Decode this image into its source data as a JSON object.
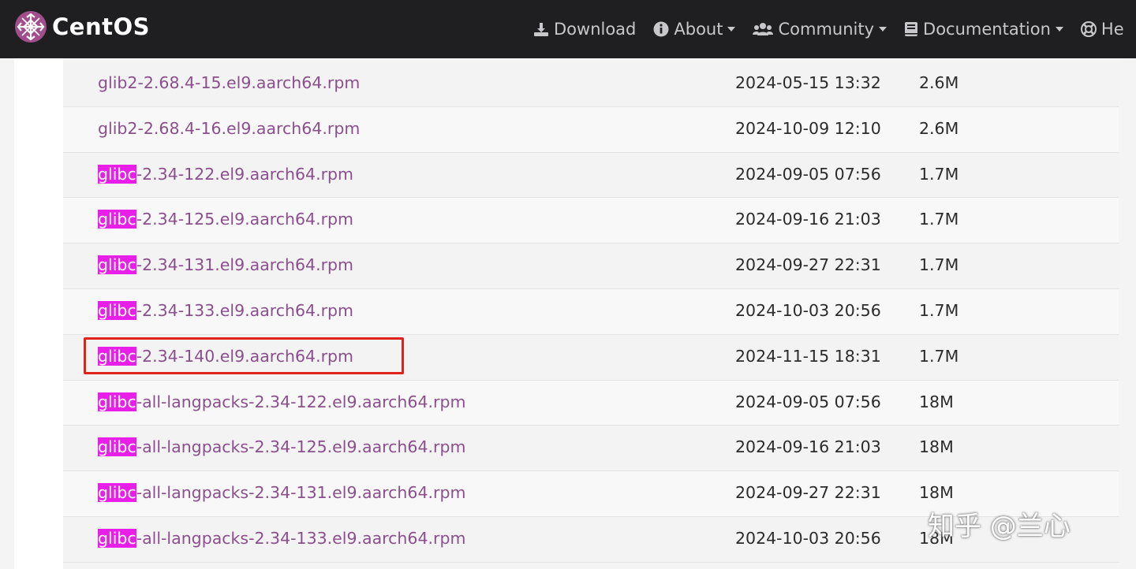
{
  "brand": {
    "name": "CentOS"
  },
  "nav": {
    "items": [
      {
        "label": "Download",
        "icon": "download-icon",
        "dropdown": false
      },
      {
        "label": "About",
        "icon": "info-icon",
        "dropdown": true
      },
      {
        "label": "Community",
        "icon": "users-icon",
        "dropdown": true
      },
      {
        "label": "Documentation",
        "icon": "book-icon",
        "dropdown": true
      },
      {
        "label": "He",
        "icon": "help-icon",
        "dropdown": false
      }
    ]
  },
  "highlight_term": "glibc",
  "files": [
    {
      "prefix": "",
      "rest": "glib2-2.68.4-15.el9.aarch64.rpm",
      "date": "2024-05-15 13:32",
      "size": "2.6M"
    },
    {
      "prefix": "",
      "rest": "glib2-2.68.4-16.el9.aarch64.rpm",
      "date": "2024-10-09 12:10",
      "size": "2.6M"
    },
    {
      "prefix": "glibc",
      "rest": "-2.34-122.el9.aarch64.rpm",
      "date": "2024-09-05 07:56",
      "size": "1.7M"
    },
    {
      "prefix": "glibc",
      "rest": "-2.34-125.el9.aarch64.rpm",
      "date": "2024-09-16 21:03",
      "size": "1.7M"
    },
    {
      "prefix": "glibc",
      "rest": "-2.34-131.el9.aarch64.rpm",
      "date": "2024-09-27 22:31",
      "size": "1.7M"
    },
    {
      "prefix": "glibc",
      "rest": "-2.34-133.el9.aarch64.rpm",
      "date": "2024-10-03 20:56",
      "size": "1.7M"
    },
    {
      "prefix": "glibc",
      "rest": "-2.34-140.el9.aarch64.rpm",
      "date": "2024-11-15 18:31",
      "size": "1.7M"
    },
    {
      "prefix": "glibc",
      "rest": "-all-langpacks-2.34-122.el9.aarch64.rpm",
      "date": "2024-09-05 07:56",
      "size": "18M"
    },
    {
      "prefix": "glibc",
      "rest": "-all-langpacks-2.34-125.el9.aarch64.rpm",
      "date": "2024-09-16 21:03",
      "size": "18M"
    },
    {
      "prefix": "glibc",
      "rest": "-all-langpacks-2.34-131.el9.aarch64.rpm",
      "date": "2024-09-27 22:31",
      "size": "18M"
    },
    {
      "prefix": "glibc",
      "rest": "-all-langpacks-2.34-133.el9.aarch64.rpm",
      "date": "2024-10-03 20:56",
      "size": "18M"
    }
  ],
  "colors": {
    "navbar": "#1f1f21",
    "link": "#8a4f8c",
    "highlight": "#e81fe8",
    "annotation": "#e0221c"
  },
  "credit": "知乎 @兰心"
}
